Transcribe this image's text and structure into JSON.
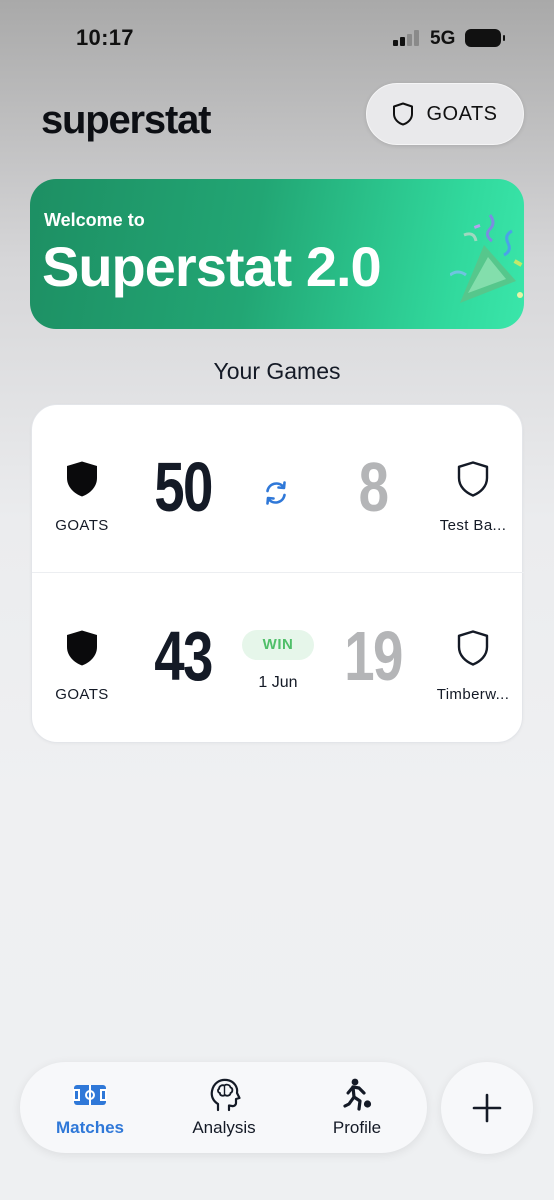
{
  "status_bar": {
    "time": "10:17",
    "network": "5G"
  },
  "header": {
    "logo": "superstat",
    "team_selector": {
      "label": "GOATS",
      "icon": "shield-outline-icon"
    }
  },
  "banner": {
    "kicker": "Welcome to",
    "title": "Superstat 2.0"
  },
  "games_section": {
    "title": "Your Games"
  },
  "games": [
    {
      "home_team": "GOATS",
      "home_score": "50",
      "away_score": "8",
      "away_team": "Test Ba...",
      "status_icon": "refresh-icon"
    },
    {
      "home_team": "GOATS",
      "home_score": "43",
      "away_score": "19",
      "away_team": "Timberw...",
      "result": "WIN",
      "date": "1 Jun"
    }
  ],
  "tab_bar": {
    "tabs": [
      {
        "label": "Matches",
        "icon": "soccer-field-icon",
        "active": true
      },
      {
        "label": "Analysis",
        "icon": "brain-head-icon",
        "active": false
      },
      {
        "label": "Profile",
        "icon": "player-ball-icon",
        "active": false
      }
    ],
    "add_icon": "plus-icon"
  },
  "colors": {
    "accent_blue": "#2f78d8",
    "win_green": "#4fbf69",
    "banner_start": "#1d8f63",
    "banner_end": "#3ae6aa"
  }
}
